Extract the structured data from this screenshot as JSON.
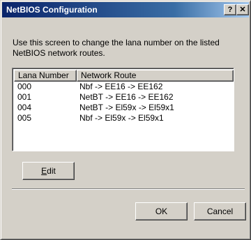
{
  "window": {
    "title": "NetBIOS Configuration",
    "help_glyph": "?",
    "close_glyph": "✕"
  },
  "description": "Use this screen to change the lana number on the listed NetBIOS network routes.",
  "list": {
    "columns": [
      "Lana Number",
      "Network Route"
    ],
    "rows": [
      {
        "lana": "000",
        "route": "Nbf -> EE16 -> EE162"
      },
      {
        "lana": "001",
        "route": "NetBT -> EE16 -> EE162"
      },
      {
        "lana": "004",
        "route": "NetBT -> El59x -> El59x1"
      },
      {
        "lana": "005",
        "route": "Nbf -> El59x -> El59x1"
      }
    ]
  },
  "buttons": {
    "edit": {
      "accel": "E",
      "rest": "dit"
    },
    "ok": "OK",
    "cancel": "Cancel"
  }
}
